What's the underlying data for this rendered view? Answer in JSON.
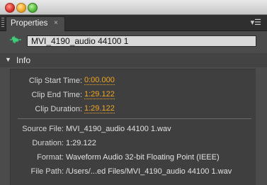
{
  "window": {
    "title_buttons": [
      "close",
      "minimize",
      "zoom"
    ]
  },
  "panel": {
    "tab_label": "Properties",
    "tab_close": "×",
    "menu_icon": "▾☰"
  },
  "clip": {
    "icon": "waveform-icon",
    "name": "MVI_4190_audio 44100 1"
  },
  "info_section": {
    "title": "Info",
    "fields": [
      {
        "label": "Clip Start Time:",
        "value": "0:00.000"
      },
      {
        "label": "Clip End Time:",
        "value": "1:29.122"
      },
      {
        "label": "Clip Duration:",
        "value": "1:29.122"
      }
    ],
    "details": [
      {
        "label": "Source File:",
        "value": "MVI_4190_audio 44100 1.wav"
      },
      {
        "label": "Duration:",
        "value": "1:29.122"
      },
      {
        "label": "Format:",
        "value": "Waveform Audio 32-bit Floating Point (IEEE)"
      },
      {
        "label": "File Path:",
        "value": "/Users/...ed Files/MVI_4190_audio 44100 1.wav"
      }
    ]
  },
  "colors": {
    "accent_link": "#f0a623",
    "panel_bg": "#4b4b4b",
    "waveform_icon": "#3fd07a"
  }
}
